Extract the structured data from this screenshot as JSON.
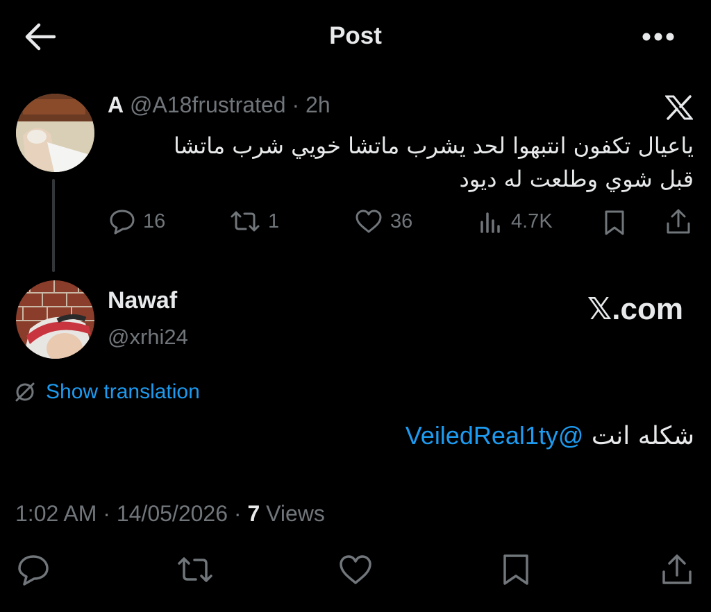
{
  "header": {
    "title": "Post",
    "back_icon": "arrow-left-icon",
    "more_icon": "more-horizontal-icon"
  },
  "parent_tweet": {
    "name": "A",
    "handle": "@A18frustrated",
    "separator": "·",
    "time": "2h",
    "text_line1": "ياعيال تكفون انتبهوا لحد يشرب ماتشا خويي شرب ماتشا",
    "text_line2": "قبل شوي وطلعت له ديود",
    "actions": {
      "replies": "16",
      "reposts": "1",
      "likes": "36",
      "views": "4.7K"
    }
  },
  "main_tweet": {
    "name": "Nawaf",
    "handle": "@xrhi24",
    "brand": "𝕏.com",
    "show_translation": "Show translation",
    "mention": "@VeiledReal1ty",
    "text": "شكله انت",
    "time": "1:02 AM",
    "sep1": "·",
    "date": "14/05/2026",
    "sep2": "·",
    "views_count": "7",
    "views_label": "Views"
  },
  "colors": {
    "background": "#000000",
    "text": "#e7e9ea",
    "muted": "#71767b",
    "accent": "#1d9bf0"
  }
}
